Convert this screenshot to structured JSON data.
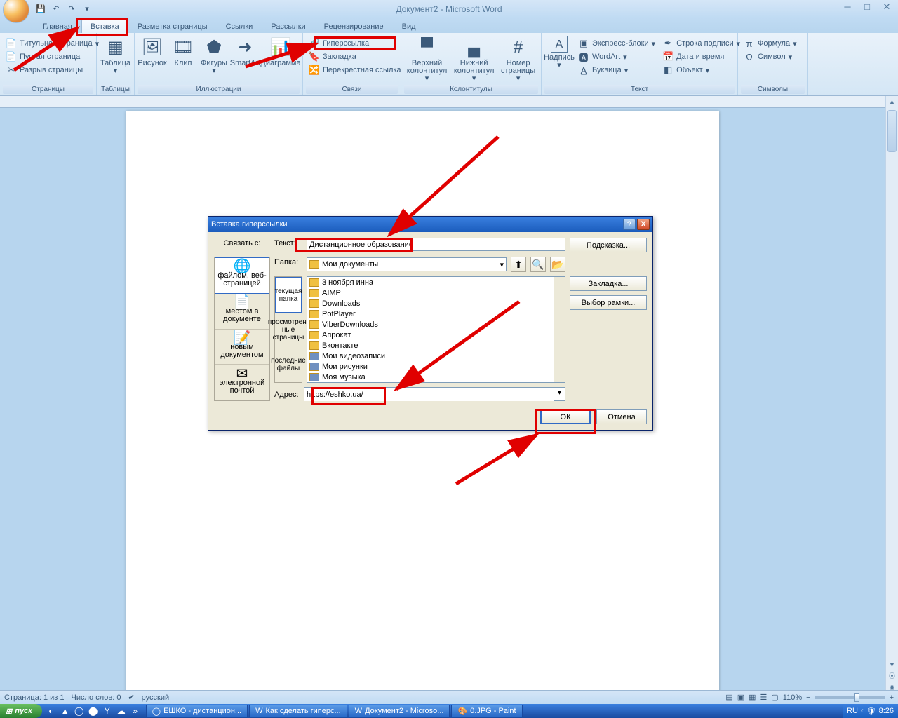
{
  "app_title": "Документ2 - Microsoft Word",
  "tabs": [
    "Главная",
    "Вставка",
    "Разметка страницы",
    "Ссылки",
    "Рассылки",
    "Рецензирование",
    "Вид"
  ],
  "active_tab": 1,
  "ribbon": {
    "pages": {
      "label": "Страницы",
      "cover": "Титульная страница",
      "blank": "Пустая страница",
      "break": "Разрыв страницы"
    },
    "tables": {
      "label": "Таблицы",
      "btn": "Таблица"
    },
    "illus": {
      "label": "Иллюстрации",
      "pic": "Рисунок",
      "clip": "Клип",
      "shapes": "Фигуры",
      "smart": "SmartArt",
      "chart": "Диаграмма"
    },
    "links": {
      "label": "Связи",
      "hyper": "Гиперссылка",
      "book": "Закладка",
      "cross": "Перекрестная ссылка"
    },
    "hf": {
      "label": "Колонтитулы",
      "top": "Верхний\nколонтитул",
      "bot": "Нижний\nколонтитул",
      "num": "Номер\nстраницы"
    },
    "text": {
      "label": "Текст",
      "box": "Надпись",
      "express": "Экспресс-блоки",
      "wordart": "WordArt",
      "dropcap": "Буквица",
      "sign": "Строка подписи",
      "date": "Дата и время",
      "obj": "Объект"
    },
    "sym": {
      "label": "Символы",
      "formula": "Формула",
      "symbol": "Символ"
    }
  },
  "dialog": {
    "title": "Вставка гиперссылки",
    "link_with": "Связать с:",
    "text_lbl": "Текст:",
    "text_val": "Дистанционное образование",
    "hint_btn": "Подсказка...",
    "folder_lbl": "Папка:",
    "folder_val": "Мои документы",
    "types": [
      "файлом, веб-страницей",
      "местом в документе",
      "новым документом",
      "электронной почтой"
    ],
    "browse": [
      "текущая папка",
      "просмотрен-ные страницы",
      "последние файлы"
    ],
    "files": [
      "3 ноября инна",
      "AIMP",
      "Downloads",
      "PotPlayer",
      "ViberDownloads",
      "Апрокат",
      "Вконтакте",
      "Мои видеозаписи",
      "Мои рисунки",
      "Моя музыка"
    ],
    "bookmark_btn": "Закладка...",
    "frame_btn": "Выбор рамки...",
    "addr_lbl": "Адрес:",
    "addr_val": "https://eshko.ua/",
    "ok": "ОК",
    "cancel": "Отмена"
  },
  "status": {
    "page": "Страница: 1 из 1",
    "words": "Число слов: 0",
    "lang": "русский",
    "zoom": "110%"
  },
  "taskbar": {
    "start": "пуск",
    "tasks": [
      "ЕШКО - дистанцион...",
      "Как сделать гиперс...",
      "Документ2 - Microso...",
      "0.JPG - Paint"
    ],
    "lang": "RU",
    "time": "8:26"
  }
}
